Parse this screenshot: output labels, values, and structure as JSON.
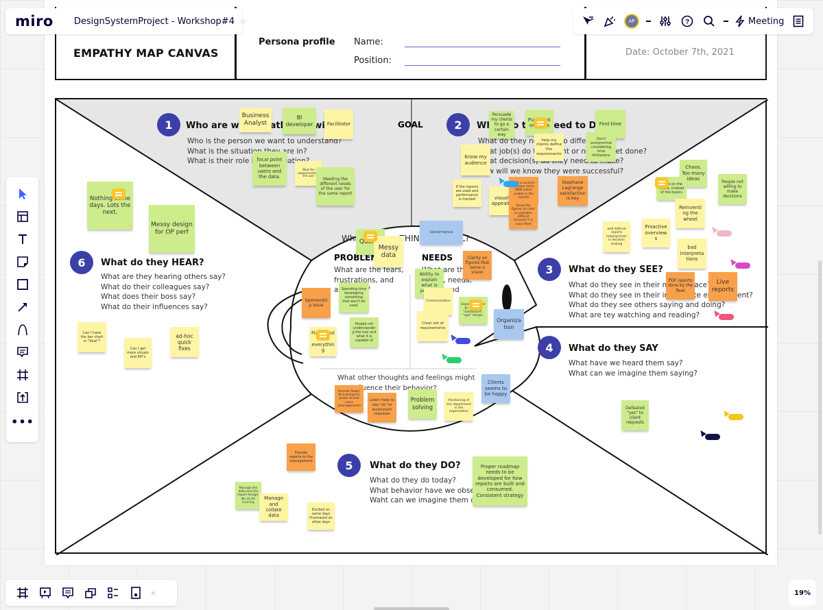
{
  "app": {
    "logo": "miro",
    "board_title": "DesignSystemProject - Workshop#4",
    "star_icon": "star-icon"
  },
  "topbar_right": {
    "icons": [
      "cursor-filter-icon",
      "celebrate-icon",
      "avatar",
      "settings-sliders-icon",
      "help-icon",
      "search-icon",
      "lightning-icon",
      "notes-icon"
    ],
    "avatar_initials": "AP",
    "meeting_label": "Meeting"
  },
  "toolbar": {
    "tools": [
      "select",
      "templates",
      "text",
      "sticky-note",
      "shape",
      "arrow",
      "pen",
      "comment",
      "frame",
      "upload",
      "more"
    ]
  },
  "bottom_toolbar": {
    "tools": [
      "frames",
      "presentation",
      "comments",
      "cards",
      "kanban",
      "board-panel"
    ],
    "collapse": "«"
  },
  "zoom_level": "19%",
  "header": {
    "canvas_title": "EMPATHY MAP CANVAS",
    "persona_label": "Persona profile",
    "name_label": "Name:",
    "position_label": "Position:",
    "date": "Date: October 7th, 2021"
  },
  "map": {
    "goal_label": "GOAL",
    "sections": [
      {
        "num": "1",
        "title": "Who are we empathizing with?",
        "questions": [
          "Who is the person we want to understand?",
          "What is the situation they are in?",
          "What is their role in the situation?"
        ]
      },
      {
        "num": "2",
        "title": "What do they need to DO",
        "questions": [
          "What do they need to do differently?",
          "What job(s) do they want or need to get done?",
          "What decision(s) do they need to make?",
          "How will we know they were successful?"
        ]
      },
      {
        "num": "3",
        "title": "What do they SEE?",
        "questions": [
          "What do they see in their marketplace?",
          "What do they see in their immediate environment?",
          "What do they see others saying and doing?",
          "What are tey watching and reading?"
        ]
      },
      {
        "num": "4",
        "title": "What do they SAY",
        "questions": [
          "What have we heard them say?",
          "What can we imagine them saying?"
        ]
      },
      {
        "num": "5",
        "title": "What do they DO?",
        "questions": [
          "What do they do today?",
          "What behavior have we observed?",
          "Waht can we imagine them doing?"
        ]
      },
      {
        "num": "6",
        "title": "What do they HEAR?",
        "questions": [
          "What are they hearing others say?",
          "What do their colleagues say?",
          "What does their boss say?",
          "What do their influences say?"
        ]
      }
    ],
    "think_feel": {
      "title": "What do they THINK and FEEL?",
      "pains_title": "PROBLEMS",
      "pains_text": [
        "What are the fears,",
        "frustrations, and",
        "anxieties?"
      ],
      "needs_title": "NEEDS",
      "needs_text": [
        "What are their",
        "wants, needs,",
        "hopes and",
        "dreams?"
      ],
      "other_q": [
        "What other thoughts and feelings might",
        "influence their behavior?"
      ]
    }
  },
  "stickies": [
    {
      "text": "Business Analyst",
      "color": "y"
    },
    {
      "text": "BI developer",
      "color": "g"
    },
    {
      "text": "Facilitator",
      "color": "y"
    },
    {
      "text": "focal point between users and the data.",
      "color": "g"
    },
    {
      "text": "Meet the requirements of the user",
      "color": "y"
    },
    {
      "text": "Meeting the different needs of the user for the same report",
      "color": "g"
    },
    {
      "text": "Persuade my clients to go a certain way",
      "color": "g"
    },
    {
      "text": "Pushback on ideas",
      "color": "g"
    },
    {
      "text": "help my clients define the requirements",
      "color": "y"
    },
    {
      "text": "Find time",
      "color": "g"
    },
    {
      "text": "Don't overpromise considering time limitations",
      "color": "g"
    },
    {
      "text": "Know my audience",
      "color": "y"
    },
    {
      "text": "If the reports are used and performance is tracked",
      "color": "y"
    },
    {
      "text": "visually appealing",
      "color": "y"
    },
    {
      "text": "Find a solution to have more DBM colors usable in the reports",
      "color": "o"
    },
    {
      "text": "Show the figures as clear as possible, difficult because it is cross fleet",
      "color": "o"
    },
    {
      "text": "Stephane Lagrange satisfaction is key",
      "color": "o"
    },
    {
      "text": "Chaos. Too many ideas",
      "color": "g"
    },
    {
      "text": "Focus on the future, instead of the basics",
      "color": "g"
    },
    {
      "text": "People not willing to make decisions",
      "color": "g"
    },
    {
      "text": "Reinventing the wheel",
      "color": "y"
    },
    {
      "text": "well defined reports helping them in decision making",
      "color": "y"
    },
    {
      "text": "Proactive overviews",
      "color": "y"
    },
    {
      "text": "bad interpretations",
      "color": "y"
    },
    {
      "text": "PDF reports done by the fleet",
      "color": "o"
    },
    {
      "text": "Live reports",
      "color": "o"
    },
    {
      "text": "Nothing some days. Lots the next.",
      "color": "g"
    },
    {
      "text": "Messy design for OP perf",
      "color": "g"
    },
    {
      "text": "Can I have the bar chart in \"blue\"?",
      "color": "y"
    },
    {
      "text": "Can I get more visuals and KPI's",
      "color": "y"
    },
    {
      "text": "ad-hoc quick fixes",
      "color": "y"
    },
    {
      "text": "Quality",
      "color": "g"
    },
    {
      "text": "Messy data",
      "color": "y"
    },
    {
      "text": "Governance",
      "color": "b"
    },
    {
      "text": "Clarity on figures that serve a vision",
      "color": "o"
    },
    {
      "text": "Sponsorship issue",
      "color": "o"
    },
    {
      "text": "Spending time developing something that won't be used.",
      "color": "g"
    },
    {
      "text": "Ability to explain what is possible",
      "color": "g"
    },
    {
      "text": "Communication",
      "color": "y"
    },
    {
      "text": "Separate Power BI \"report\", \"dashboard\", \"app\" design.",
      "color": "g"
    },
    {
      "text": "Organization",
      "color": "b"
    },
    {
      "text": "People not understanding the tool and what it is capable of",
      "color": "g"
    },
    {
      "text": "Fix IT Tool for everything",
      "color": "y"
    },
    {
      "text": "Clear set of requirements",
      "color": "y"
    },
    {
      "text": "Provide Power BI training for power bi end users (management)",
      "color": "o"
    },
    {
      "text": "Learn how to say 'no' to inconstant requests",
      "color": "o"
    },
    {
      "text": "Problem solving",
      "color": "g"
    },
    {
      "text": "Positioning of the department in the organization",
      "color": "y"
    },
    {
      "text": "Clients seems to be happy",
      "color": "b"
    },
    {
      "text": "Defeated \"yes\" to client requests",
      "color": "g"
    },
    {
      "text": "Provide reports to the management",
      "color": "o"
    },
    {
      "text": "Manage the data and the report design. No UI,UX training",
      "color": "g"
    },
    {
      "text": "Manage and collate data",
      "color": "y"
    },
    {
      "text": "Excited on some days Frustrated on other days",
      "color": "y"
    },
    {
      "text": "Proper roadmap needs to be developed for how reports are built and consumed. Consistent strategy",
      "color": "g"
    }
  ],
  "collaborator_cursors": [
    {
      "color": "#2fa6f0"
    },
    {
      "color": "#f2b6c9"
    },
    {
      "color": "#d64ac7"
    },
    {
      "color": "#f0557a"
    },
    {
      "color": "#3b4de0"
    },
    {
      "color": "#2ecc71"
    },
    {
      "color": "#f5c518"
    },
    {
      "color": "#14124a"
    }
  ]
}
